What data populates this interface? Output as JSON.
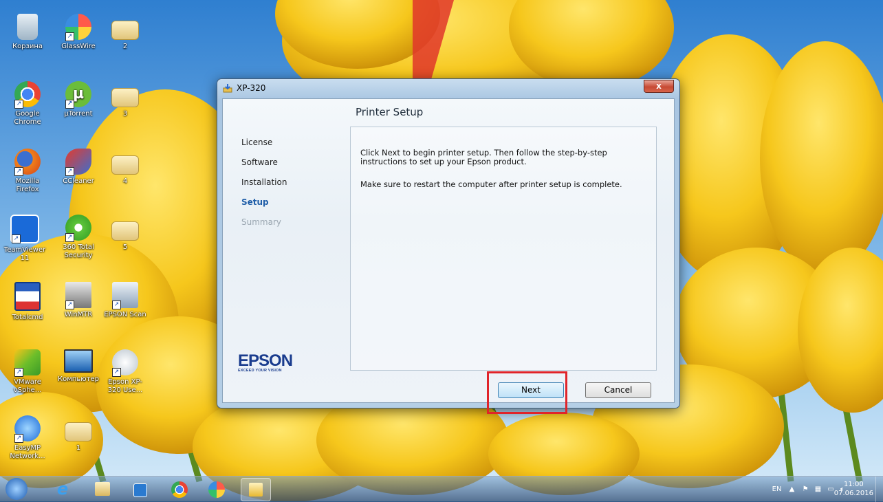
{
  "desktop": {
    "icons": [
      {
        "label": "Корзина",
        "icon": "recycle-bin-icon"
      },
      {
        "label": "GlassWire",
        "icon": "glasswire-icon"
      },
      {
        "label": "2",
        "icon": "folder-icon"
      },
      {
        "label": "Google Chrome",
        "icon": "chrome-icon"
      },
      {
        "label": "µTorrent",
        "icon": "utorrent-icon"
      },
      {
        "label": "3",
        "icon": "folder-icon"
      },
      {
        "label": "Mozilla Firefox",
        "icon": "firefox-icon"
      },
      {
        "label": "CCleaner",
        "icon": "ccleaner-icon"
      },
      {
        "label": "4",
        "icon": "folder-icon"
      },
      {
        "label": "TeamViewer 11",
        "icon": "teamviewer-icon"
      },
      {
        "label": "360 Total Security",
        "icon": "360-security-icon"
      },
      {
        "label": "5",
        "icon": "folder-icon"
      },
      {
        "label": "Totalcmd",
        "icon": "floppy-icon"
      },
      {
        "label": "WinMTR",
        "icon": "winmtr-icon"
      },
      {
        "label": "EPSON Scan",
        "icon": "scanner-icon"
      },
      {
        "label": "VMware vSphe...",
        "icon": "vmware-icon"
      },
      {
        "label": "Компьютер",
        "icon": "computer-icon"
      },
      {
        "label": "Epson XP-320 Use...",
        "icon": "epson-manual-icon"
      },
      {
        "label": "EasyMP Network...",
        "icon": "easymp-icon"
      },
      {
        "label": "1",
        "icon": "folder-icon"
      }
    ]
  },
  "window": {
    "title": "XP-320",
    "close_label": "x",
    "heading": "Printer Setup",
    "steps": [
      "License",
      "Software",
      "Installation",
      "Setup",
      "Summary"
    ],
    "active_step": "Setup",
    "message1": "Click Next to begin printer setup. Then follow the step-by-step instructions to set up your Epson product.",
    "message2": "Make sure to restart the computer after printer setup is complete.",
    "logo_brand": "EPSON",
    "logo_tagline": "EXCEED YOUR VISION",
    "next_label": "Next",
    "cancel_label": "Cancel"
  },
  "taskbar": {
    "apps": [
      "start-orb-icon",
      "internet-explorer-icon",
      "file-explorer-icon",
      "media-player-icon",
      "chrome-icon",
      "glasswire-icon",
      "epson-installer-icon"
    ],
    "language": "EN",
    "time": "11:00",
    "date": "07.06.2016"
  },
  "colors": {
    "highlight": "#e0242a",
    "accent": "#1f5ea8"
  }
}
